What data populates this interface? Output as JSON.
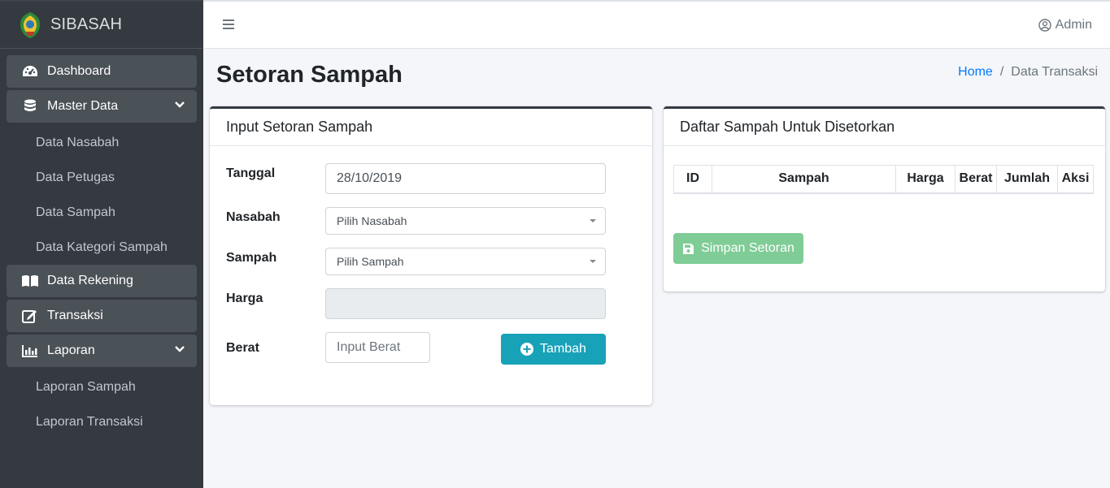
{
  "brand": {
    "name": "SIBASAH"
  },
  "sidebar": {
    "dashboard": "Dashboard",
    "master_data": "Master Data",
    "master_sub": [
      "Data Nasabah",
      "Data Petugas",
      "Data Sampah",
      "Data Kategori Sampah"
    ],
    "data_rekening": "Data Rekening",
    "transaksi": "Transaksi",
    "laporan": "Laporan",
    "laporan_sub": [
      "Laporan Sampah",
      "Laporan Transaksi"
    ]
  },
  "topbar": {
    "user": "Admin"
  },
  "page": {
    "title": "Setoran Sampah"
  },
  "breadcrumb": {
    "home": "Home",
    "separator": "/",
    "current": "Data Transaksi"
  },
  "form_card": {
    "title": "Input Setoran Sampah",
    "tanggal_label": "Tanggal",
    "tanggal_value": "28/10/2019",
    "nasabah_label": "Nasabah",
    "nasabah_selected": "Pilih Nasabah",
    "sampah_label": "Sampah",
    "sampah_selected": "Pilih Sampah",
    "harga_label": "Harga",
    "harga_value": "",
    "berat_label": "Berat",
    "berat_placeholder": "Input Berat",
    "tambah_button": "Tambah"
  },
  "list_card": {
    "title": "Daftar Sampah Untuk Disetorkan",
    "columns": [
      "ID",
      "Sampah",
      "Harga",
      "Berat",
      "Jumlah",
      "Aksi"
    ],
    "save_button": "Simpan Setoran"
  },
  "colors": {
    "sidebar_bg": "#343a40",
    "primary_link": "#007bff",
    "info_button": "#17a2b8",
    "success_button": "#7fcc96"
  }
}
